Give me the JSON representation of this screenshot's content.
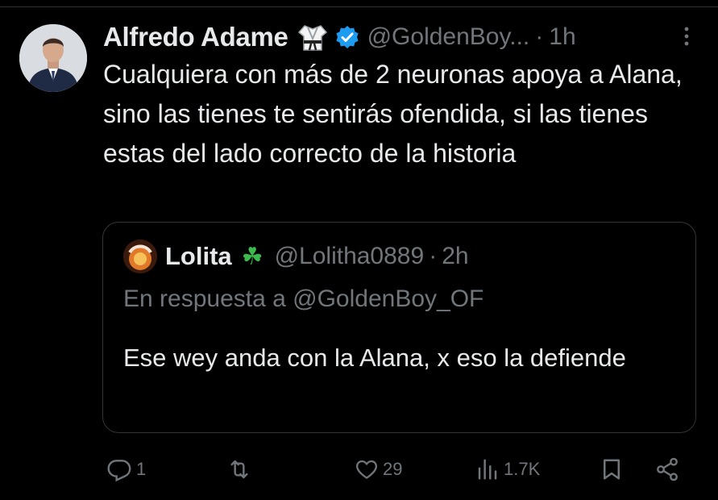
{
  "tweet": {
    "author_name": "Alfredo Adame",
    "handle": "@GoldenBoy...",
    "separator": "·",
    "time": "1h",
    "text": "Cualquiera con más de 2 neuronas apoya a Alana, sino las tienes te sentirás ofendida, si las tienes estas del lado correcto de la historia",
    "badge_color": "#1d9bf0",
    "icons": [
      "karate-gi-emoji",
      "verified-badge",
      "more-options-icon"
    ]
  },
  "quoted": {
    "author_name": "Lolita",
    "emoji": "☘",
    "handle": "@Lolitha0889",
    "separator": "·",
    "time": "2h",
    "reply_to": "En respuesta a @GoldenBoy_OF",
    "text": "Ese wey anda con la Alana, x eso la defiende"
  },
  "actions": {
    "replies": "1",
    "retweets": "",
    "likes": "29",
    "views": "1.7K",
    "icons": [
      "reply-icon",
      "retweet-icon",
      "like-icon",
      "views-icon",
      "bookmark-icon",
      "share-icon"
    ]
  },
  "colors": {
    "background": "#000000",
    "text": "#e7e9ea",
    "muted": "#71767b",
    "border": "#333639"
  }
}
